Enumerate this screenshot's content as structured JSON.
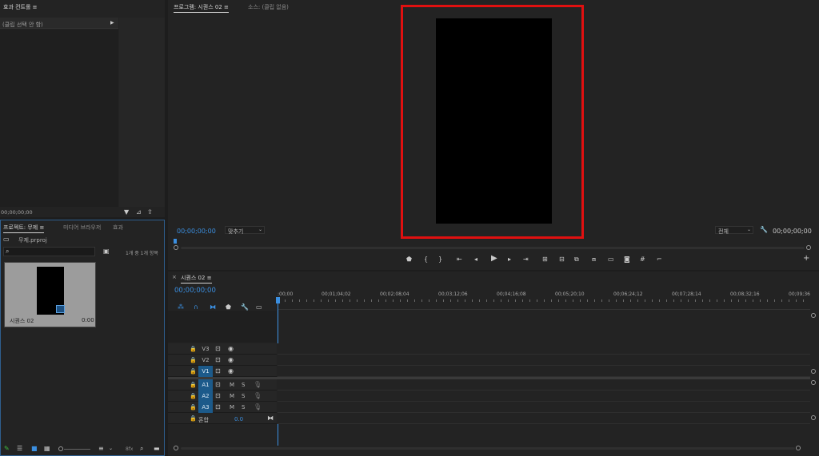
{
  "effect_controls": {
    "title": "효과 컨트롤",
    "menu_glyph": "≡",
    "no_clip": "(클립 선택 안 함)",
    "timecode": "00;00;00;00"
  },
  "program_monitor": {
    "tab_program": "프로그램: 시퀀스 02",
    "tab_source": "소스: (클립 없음)",
    "menu_glyph": "≡",
    "timecode_current": "00;00;00;00",
    "fit_label": "맞추기",
    "quality_label": "전체",
    "timecode_duration": "00;00;00;00",
    "highlight_color": "#e01010"
  },
  "project_panel": {
    "tab_project": "프로젝트: 무제",
    "tab_media": "미디어 브라우저",
    "tab_effects": "효과",
    "menu_glyph": "≡",
    "file_name": "무제.prproj",
    "item_count": "1개 중 1개 항목",
    "search_placeholder": "",
    "clip_name": "시퀀스 02",
    "clip_duration": "0:00",
    "zoom_label": "8fx"
  },
  "timeline": {
    "tab_label": "시퀀스 02",
    "close_glyph": "×",
    "menu_glyph": "≡",
    "timecode": "00;00;00;00",
    "ruler": [
      ":00;00",
      "00;01;04;02",
      "00;02;08;04",
      "00;03;12;06",
      "00;04;16;08",
      "00;05;20;10",
      "00;06;24;12",
      "00;07;28;14",
      "00;08;32;16",
      "00;09;36"
    ],
    "video_tracks": [
      "V3",
      "V2",
      "V1"
    ],
    "audio_tracks": [
      "A1",
      "A2",
      "A3"
    ],
    "mute_label": "M",
    "solo_label": "S",
    "mix_label": "혼합",
    "mix_value": "0.0"
  },
  "accent_color": "#3b8fe0"
}
